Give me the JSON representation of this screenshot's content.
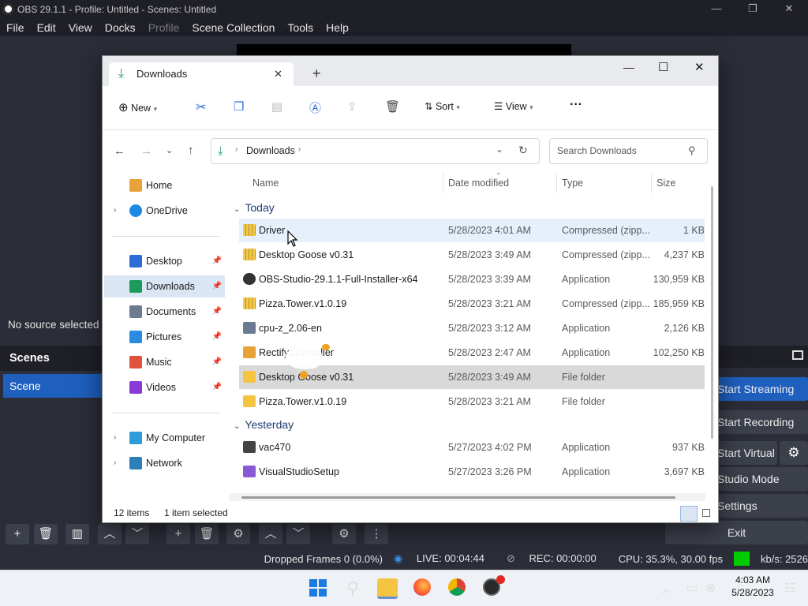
{
  "obs": {
    "title": "OBS 29.1.1 - Profile: Untitled - Scenes: Untitled",
    "menu": [
      "File",
      "Edit",
      "View",
      "Docks",
      "Profile",
      "Scene Collection",
      "Tools",
      "Help"
    ],
    "no_source": "No source selected",
    "scenes_header": "Scenes",
    "scene_item": "Scene",
    "controls": {
      "streaming": "Start Streaming",
      "recording": "Start Recording",
      "virtual_camera": "Start Virtual Camera",
      "studio_mode": "Studio Mode",
      "settings": "Settings",
      "exit": "Exit"
    },
    "status": {
      "dropped": "Dropped Frames 0 (0.0%)",
      "live": "LIVE: 00:04:44",
      "rec": "REC: 00:00:00",
      "cpu": "CPU: 35.3%, 30.00 fps",
      "kbps": "kb/s: 2526",
      "status_color": "#00cc00"
    }
  },
  "explorer": {
    "tab_title": "Downloads",
    "new_tab": "+",
    "window_controls": {
      "minimize": "—",
      "maximize": "☐",
      "close": "✕"
    },
    "toolbar": {
      "new": "New",
      "sort": "Sort",
      "view": "View",
      "more": "···"
    },
    "breadcrumb": [
      "Downloads"
    ],
    "search_placeholder": "Search Downloads",
    "nav": [
      {
        "label": "Home",
        "icon": "home-icon",
        "color": "#e8a23a"
      },
      {
        "label": "OneDrive",
        "icon": "cloud-icon",
        "color": "#1e88e5"
      },
      {
        "label": "Desktop",
        "icon": "desktop-icon",
        "color": "#2d6bd6"
      },
      {
        "label": "Downloads",
        "icon": "download-icon",
        "color": "#1e9b5a"
      },
      {
        "label": "Documents",
        "icon": "document-icon",
        "color": "#6c7c90"
      },
      {
        "label": "Pictures",
        "icon": "picture-icon",
        "color": "#2b8be0"
      },
      {
        "label": "Music",
        "icon": "music-icon",
        "color": "#e0523a"
      },
      {
        "label": "Videos",
        "icon": "video-icon",
        "color": "#8a3ad6"
      },
      {
        "label": "My Computer",
        "icon": "computer-icon",
        "color": "#2d9cdb"
      },
      {
        "label": "Network",
        "icon": "network-icon",
        "color": "#2d7fb8"
      }
    ],
    "columns": [
      "Name",
      "Date modified",
      "Type",
      "Size"
    ],
    "groups": {
      "today": "Today",
      "yesterday": "Yesterday"
    },
    "files": [
      {
        "name": "Driver",
        "date": "5/28/2023 4:01 AM",
        "type": "Compressed (zipp...",
        "size": "1 KB",
        "kind": "zip"
      },
      {
        "name": "Desktop Goose v0.31",
        "date": "5/28/2023 3:49 AM",
        "type": "Compressed (zipp...",
        "size": "4,237 KB",
        "kind": "zip"
      },
      {
        "name": "OBS-Studio-29.1.1-Full-Installer-x64",
        "date": "5/28/2023 3:39 AM",
        "type": "Application",
        "size": "130,959 KB",
        "kind": "app"
      },
      {
        "name": "Pizza.Tower.v1.0.19",
        "date": "5/28/2023 3:21 AM",
        "type": "Compressed (zipp...",
        "size": "185,959 KB",
        "kind": "zip"
      },
      {
        "name": "cpu-z_2.06-en",
        "date": "5/28/2023 3:12 AM",
        "type": "Application",
        "size": "2,126 KB",
        "kind": "app"
      },
      {
        "name": "Rectify11Installer",
        "date": "5/28/2023 2:47 AM",
        "type": "Application",
        "size": "102,250 KB",
        "kind": "app"
      },
      {
        "name": "Desktop Goose v0.31",
        "date": "5/28/2023 3:49 AM",
        "type": "File folder",
        "size": "",
        "kind": "folder"
      },
      {
        "name": "Pizza.Tower.v1.0.19",
        "date": "5/28/2023 3:21 AM",
        "type": "File folder",
        "size": "",
        "kind": "folder"
      },
      {
        "name": "vac470",
        "date": "5/27/2023 4:02 PM",
        "type": "Application",
        "size": "937 KB",
        "kind": "app"
      },
      {
        "name": "VisualStudioSetup",
        "date": "5/27/2023 3:26 PM",
        "type": "Application",
        "size": "3,697 KB",
        "kind": "app"
      }
    ],
    "status": {
      "items": "12 items",
      "selected": "1 item selected"
    }
  },
  "taskbar": {
    "time": "4:03 AM",
    "date": "5/28/2023"
  }
}
